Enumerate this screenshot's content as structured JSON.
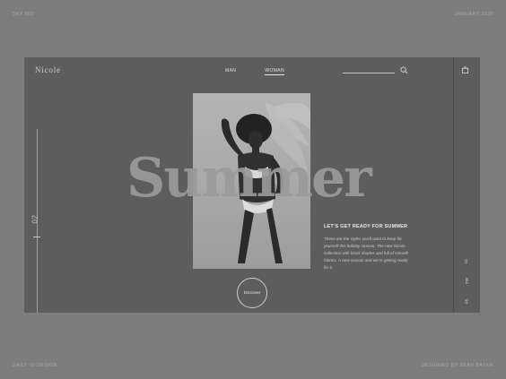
{
  "corners": {
    "top_left": "SKY 003",
    "top_right": "JANUARY 2020",
    "bottom_left": "DAILY UI DESIGN",
    "bottom_right": "DESIGNED BY SEAN BAYER"
  },
  "header": {
    "logo": "Nicole",
    "nav": [
      {
        "label": "MAN",
        "active": false
      },
      {
        "label": "WOMAN",
        "active": true
      }
    ]
  },
  "hero": {
    "headline": "Summer",
    "page_number": "02",
    "subtitle": "LET'S GET READY FOR SUMMER",
    "body": "These are the styles you'll want to keep for yourself this holiday season. The new Nicole collection with black shades and full of smooth fabrics. A new season and we're getting ready for it.",
    "cta": "Discover"
  },
  "social": [
    "FB",
    "TW",
    "IG"
  ],
  "icons": {
    "search": "search-icon",
    "bag": "shopping-bag-icon"
  }
}
